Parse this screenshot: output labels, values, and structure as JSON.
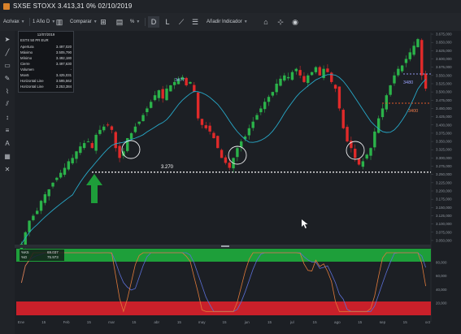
{
  "window": {
    "title": "SXSE STOXX 3.413,31 0% 02/10/2019"
  },
  "toolbar": {
    "symbol": "Acrivax",
    "period": "1 Año D",
    "compare": "Comparar",
    "pct": "%",
    "d_btn": "D",
    "l_btn": "L",
    "add_indicator": "Añadir Indicador"
  },
  "infobox": {
    "date": "12/07/2019",
    "symbol": "ESTX 50 PR EUR",
    "rows": [
      {
        "label": "Apertura",
        "value": "3.497,020"
      },
      {
        "label": "Máximo",
        "value": "3.505,790"
      },
      {
        "label": "Mínimo",
        "value": "3.492,180"
      },
      {
        "label": "Cierre",
        "value": "3.497,630"
      },
      {
        "label": "Volumen",
        "value": "-"
      },
      {
        "label": "Mov5",
        "value": "3.425,031"
      },
      {
        "label": "Horizontal Line",
        "value": "3.595,562"
      },
      {
        "label": "Horizontal Line",
        "value": "3.253,384"
      }
    ]
  },
  "annotations": {
    "support": "3.270",
    "a1": "3477",
    "a2": "3480",
    "a3": "3400"
  },
  "osc": {
    "k_label": "%K5",
    "k_val": "69.037",
    "d_label": "%D",
    "d_val": "75.973"
  },
  "colors": {
    "up": "#2bb34a",
    "down": "#e02a2a",
    "ma": "#27a8c8",
    "bg": "#1c1f24",
    "osc_green": "#1e9f3a",
    "osc_red": "#c9202a",
    "k_line": "#e07a3a",
    "d_line": "#5b6fd6"
  },
  "chart_data": {
    "type": "candlestick",
    "price_axis": [
      "3.675,000",
      "3.650,000",
      "3.625,000",
      "3.600,000",
      "3.575,000",
      "3.550,000",
      "3.525,000",
      "3.500,000",
      "3.475,000",
      "3.450,000",
      "3.425,000",
      "3.400,000",
      "3.375,000",
      "3.350,000",
      "3.325,000",
      "3.300,000",
      "3.275,000",
      "3.250,000",
      "3.225,000",
      "3.200,000",
      "3.175,000",
      "3.150,000",
      "3.125,000",
      "3.100,000",
      "3.075,000",
      "3.050,000"
    ],
    "osc_axis": [
      "80,000",
      "60,000",
      "40,000",
      "20,000"
    ],
    "x_axis": [
      "Ene",
      "15",
      "Feb",
      "15",
      "mar",
      "15",
      "abr",
      "15",
      "may",
      "15",
      "jun",
      "15",
      "jul",
      "15",
      "ago",
      "15",
      "sep",
      "15",
      "oct"
    ],
    "close": [
      3040,
      3075,
      3110,
      3125,
      3140,
      3170,
      3190,
      3205,
      3225,
      3240,
      3255,
      3270,
      3290,
      3300,
      3320,
      3335,
      3345,
      3350,
      3330,
      3370,
      3385,
      3395,
      3400,
      3385,
      3330,
      3300,
      3320,
      3360,
      3375,
      3395,
      3410,
      3430,
      3450,
      3470,
      3490,
      3505,
      3480,
      3510,
      3520,
      3530,
      3540,
      3545,
      3520,
      3530,
      3500,
      3420,
      3400,
      3390,
      3380,
      3360,
      3330,
      3300,
      3285,
      3270,
      3300,
      3330,
      3350,
      3365,
      3390,
      3410,
      3430,
      3450,
      3470,
      3485,
      3500,
      3525,
      3540,
      3550,
      3545,
      3560,
      3570,
      3550,
      3530,
      3550,
      3560,
      3575,
      3550,
      3570,
      3560,
      3530,
      3510,
      3450,
      3390,
      3350,
      3330,
      3300,
      3280,
      3290,
      3310,
      3330,
      3380,
      3420,
      3450,
      3490,
      3520,
      3550,
      3570,
      3580,
      3600,
      3620,
      3640,
      3660,
      3550,
      3510
    ]
  }
}
